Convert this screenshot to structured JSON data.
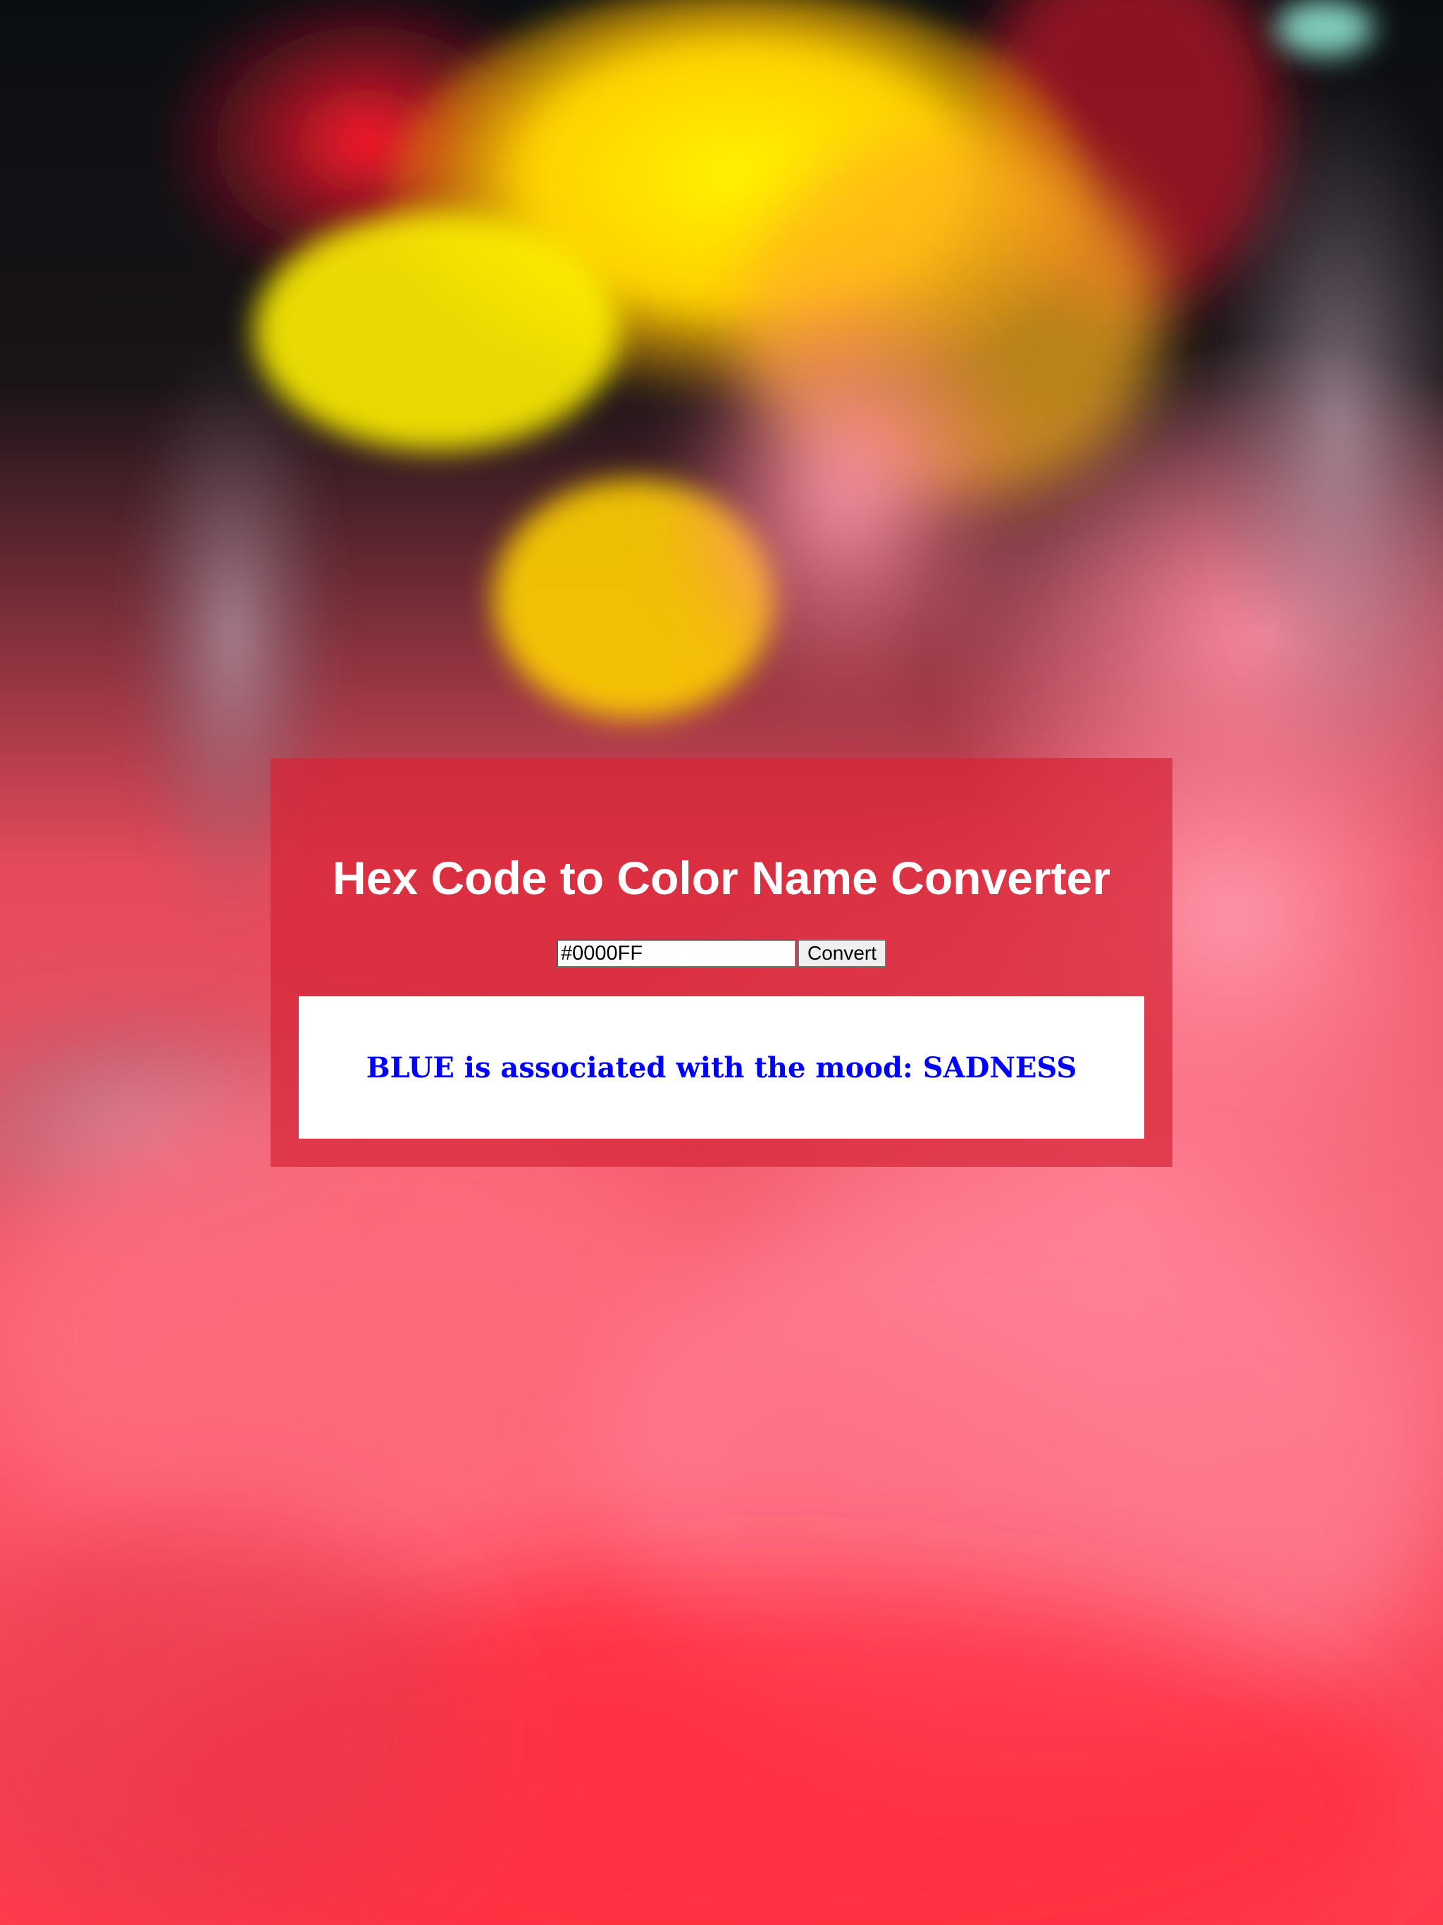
{
  "page": {
    "title": "Hex Code to Color Name Converter"
  },
  "form": {
    "input_value": "#0000FF",
    "button_label": "Convert"
  },
  "result": {
    "text": "BLUE is associated with the mood: SADNESS",
    "text_color": "#0000FF"
  },
  "colors": {
    "panel_background": "rgba(214, 38, 56, 0.72)",
    "title_color": "#FFFFFF",
    "result_box_background": "#FFFFFF"
  }
}
